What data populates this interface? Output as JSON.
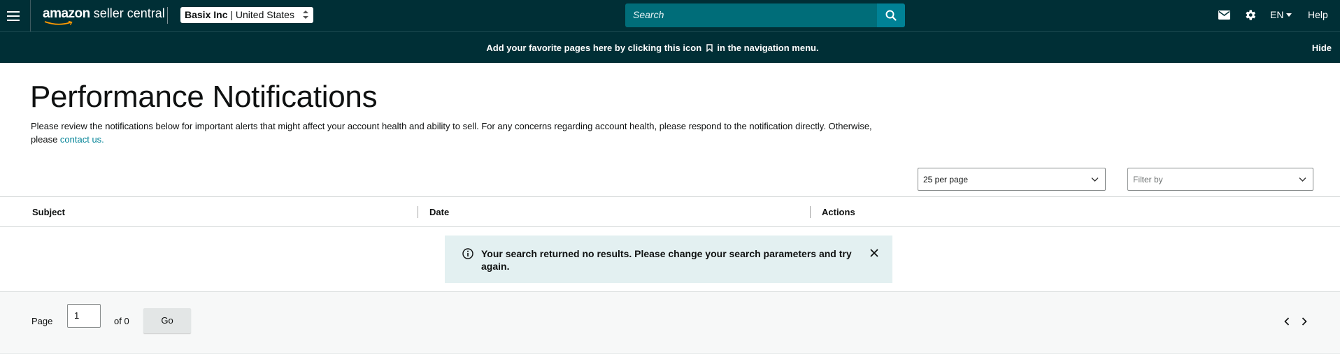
{
  "header": {
    "logo_brand": "amazon",
    "logo_rest": " seller central",
    "account_name": "Basix Inc",
    "account_sep": " | ",
    "account_region": "United States",
    "search_placeholder": "Search",
    "language": "EN",
    "help": "Help",
    "icons": [
      "hamburger-menu-icon",
      "mail-icon",
      "gear-icon",
      "search-icon"
    ]
  },
  "favorites_banner": {
    "text_before": "Add your favorite pages here by clicking this icon",
    "text_after": "in the navigation menu.",
    "hide": "Hide"
  },
  "page": {
    "title": "Performance Notifications",
    "intro_text": "Please review the notifications below for important alerts that might affect your account health and ability to sell. For any concerns regarding account health, please respond to the notification directly. Otherwise, please ",
    "contact_link": "contact us.",
    "per_page": "25 per page",
    "filter_placeholder": "Filter by"
  },
  "table": {
    "columns": [
      "Subject",
      "Date",
      "Actions"
    ],
    "empty_message": "Your search returned no results. Please change your search parameters and try again."
  },
  "pagination": {
    "page_label": "Page",
    "current_page": "1",
    "of_label": "of 0",
    "go_label": "Go"
  },
  "colors": {
    "header_bg": "#002f36",
    "search_bg": "#006d79",
    "search_button": "#008296",
    "link": "#008296",
    "alert_bg": "#e3f0f1"
  }
}
